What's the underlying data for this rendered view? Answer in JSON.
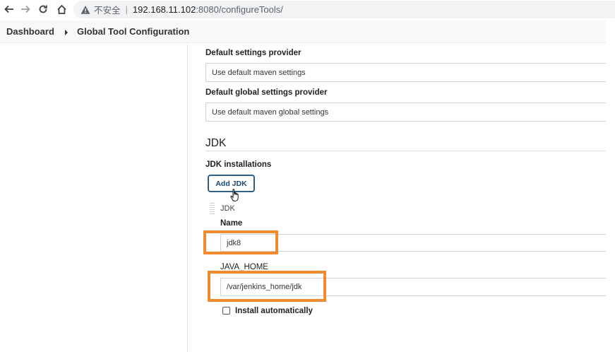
{
  "browser": {
    "insecure_text": "不安全",
    "separator": "|",
    "url_host": "192.168.11.102",
    "url_path": ":8080/configureTools/"
  },
  "breadcrumb": {
    "items": [
      "Dashboard",
      "Global Tool Configuration"
    ]
  },
  "maven": {
    "settings_label": "Default settings provider",
    "settings_value": "Use default maven settings",
    "global_settings_label": "Default global settings provider",
    "global_settings_value": "Use default maven global settings"
  },
  "jdk": {
    "section_title": "JDK",
    "installations_label": "JDK installations",
    "add_button": "Add JDK",
    "item_header": "JDK",
    "name_label": "Name",
    "name_value": "jdk8",
    "java_home_label": "JAVA_HOME",
    "java_home_value": "/var/jenkins_home/jdk",
    "install_auto_label": "Install automatically",
    "install_auto_checked": false
  },
  "colors": {
    "highlight": "#f28a2e",
    "button_border": "#2d5f87"
  }
}
